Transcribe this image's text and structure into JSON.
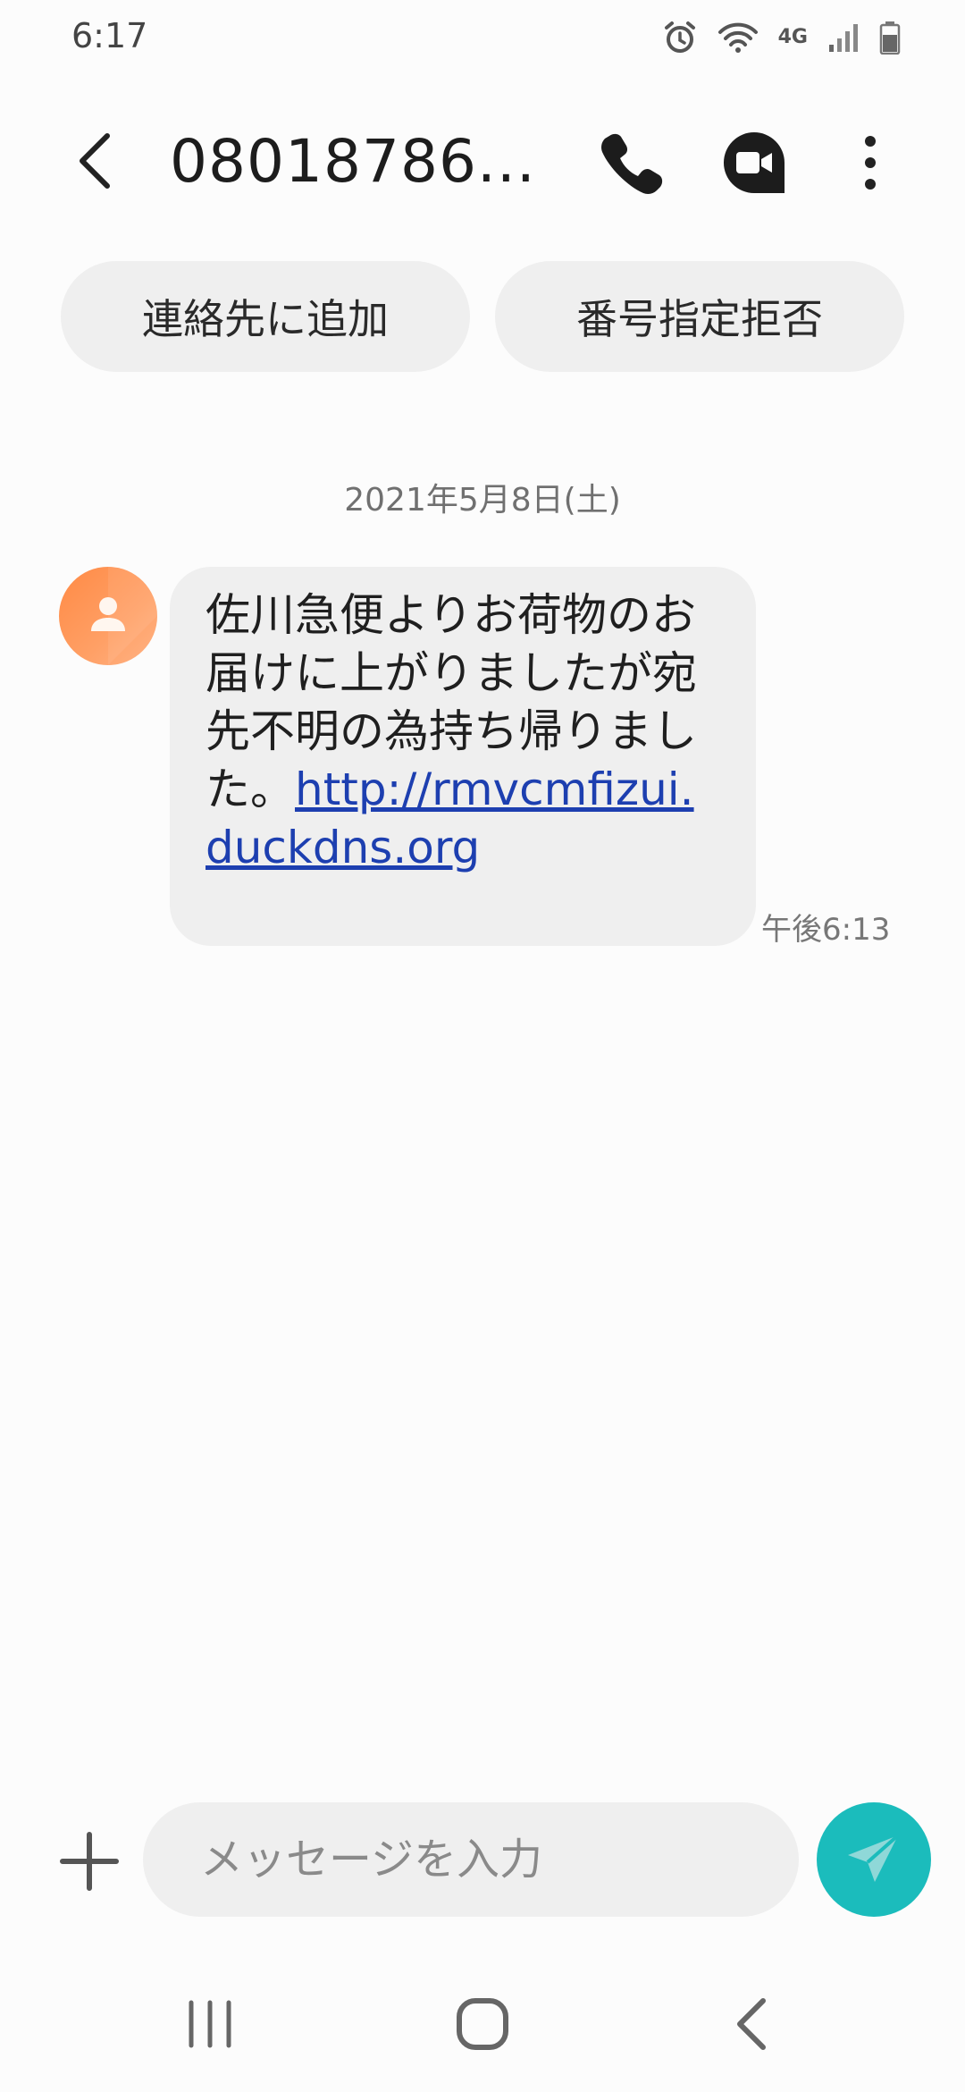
{
  "status_bar": {
    "time": "6:17",
    "network": "4G",
    "icons": [
      "alarm-icon",
      "wifi-icon",
      "network-4g-icon",
      "signal-icon",
      "battery-icon"
    ]
  },
  "header": {
    "contact_number": "08018786...",
    "icons": [
      "back-arrow-icon",
      "phone-icon",
      "video-call-icon",
      "more-vert-icon"
    ]
  },
  "actions": {
    "add_contact_label": "連絡先に追加",
    "block_number_label": "番号指定拒否"
  },
  "conversation": {
    "date": "2021年5月8日(土)",
    "messages": [
      {
        "text": "佐川急便よりお荷物のお届けに上がりましたが宛先不明の為持ち帰りました。",
        "link": "http://rmvcmfizui.duckdns.org",
        "time": "午後6:13"
      }
    ]
  },
  "composer": {
    "placeholder": "メッセージを入力",
    "icons": [
      "plus-icon",
      "send-icon"
    ]
  },
  "nav_bar": {
    "icons": [
      "recents-icon",
      "home-icon",
      "back-icon"
    ]
  },
  "colors": {
    "background": "#fcfcfc",
    "bubble": "#efefef",
    "link": "#1d3fb0",
    "send_button": "#1bbcbc",
    "avatar": "#ff8a45"
  }
}
